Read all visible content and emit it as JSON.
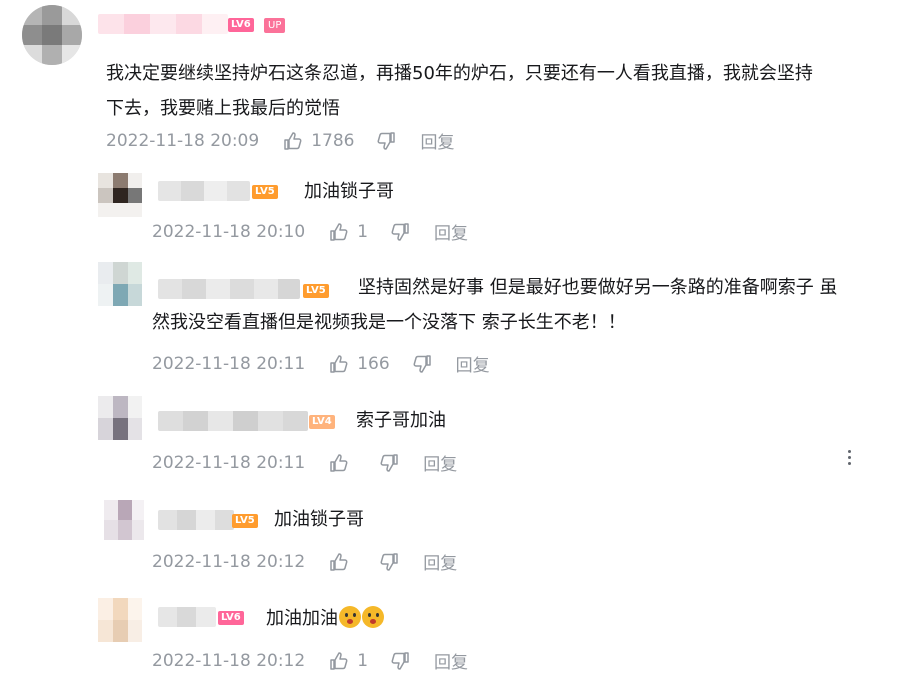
{
  "comments": [
    {
      "level": "LV6",
      "up_badge": "UP",
      "content_line1": "我决定要继续坚持炉石这条忍道，再播50年的炉石，只要还有一人看我直播，我就会坚持",
      "content_line2": "下去，我要赌上我最后的觉悟",
      "date": "2022-11-18 20:09",
      "likes": "1786",
      "reply": "回复"
    }
  ],
  "replies": [
    {
      "level": "LV5",
      "content": "加油锁子哥",
      "date": "2022-11-18 20:10",
      "likes": "1",
      "reply": "回复"
    },
    {
      "level": "LV5",
      "content_line1": "坚持固然是好事 但是最好也要做好另一条路的准备啊索子 虽",
      "content_line2": "然我没空看直播但是视频我是一个没落下 索子长生不老！！",
      "date": "2022-11-18 20:11",
      "likes": "166",
      "reply": "回复"
    },
    {
      "level": "LV4",
      "content": "索子哥加油",
      "date": "2022-11-18 20:11",
      "likes": "",
      "reply": "回复"
    },
    {
      "level": "LV5",
      "content": "加油锁子哥",
      "date": "2022-11-18 20:12",
      "likes": "",
      "reply": "回复"
    },
    {
      "level": "LV6",
      "content": "加油加油",
      "emoji_icons": [
        "scream-emoji-icon",
        "scream-emoji-icon"
      ],
      "date": "2022-11-18 20:12",
      "likes": "1",
      "reply": "回复"
    }
  ],
  "colors": {
    "lv6": "#ff6699",
    "lv5": "#ff9c2e",
    "lv4": "#ffb37c",
    "up": "#fb7299",
    "meta": "#9499a0"
  }
}
